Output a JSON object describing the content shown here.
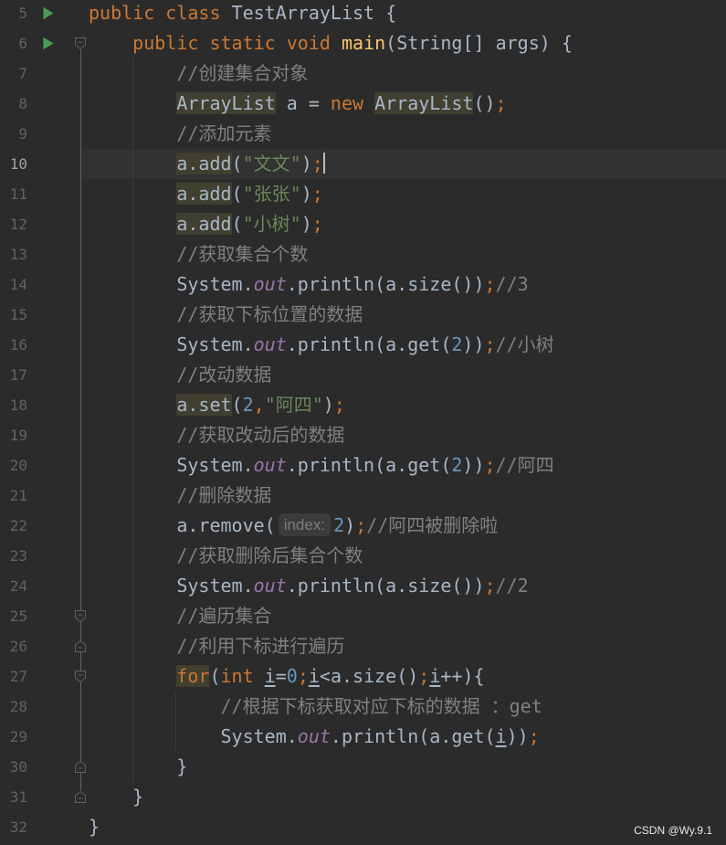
{
  "editor": {
    "theme": {
      "background": "#2b2b2b",
      "current_line_background": "#323232",
      "text": "#a9b7c6",
      "keyword": "#cc7832",
      "method": "#ffc66d",
      "comment": "#808080",
      "string": "#6a8759",
      "number": "#6897bb",
      "field": "#9876aa",
      "line_number": "#606366",
      "line_number_current": "#a4a3a3",
      "usage_highlight": "#403f30",
      "hint_background": "#3b3b3c",
      "hint_text": "#7e7e7e",
      "run_icon": "#499c54",
      "fold_marker": "#5f6366",
      "indent_guide": "#3c3c3c",
      "caret": "#bbbbbb"
    },
    "current_line": 10,
    "lines": [
      {
        "number": "5",
        "run_icon": "run-icon",
        "fold": null,
        "tokens": [
          {
            "type": "keyword",
            "text": "public"
          },
          {
            "type": "text",
            "text": " "
          },
          {
            "type": "keyword",
            "text": "class"
          },
          {
            "type": "text",
            "text": " TestArrayList {"
          }
        ]
      },
      {
        "number": "6",
        "run_icon": "run-icon",
        "fold": "fold-start-icon",
        "tokens": [
          {
            "type": "text",
            "text": "    "
          },
          {
            "type": "keyword",
            "text": "public"
          },
          {
            "type": "text",
            "text": " "
          },
          {
            "type": "keyword",
            "text": "static"
          },
          {
            "type": "text",
            "text": " "
          },
          {
            "type": "keyword",
            "text": "void"
          },
          {
            "type": "text",
            "text": " "
          },
          {
            "type": "method",
            "text": "main"
          },
          {
            "type": "text",
            "text": "(String[] args) {"
          }
        ]
      },
      {
        "number": "7",
        "run_icon": null,
        "fold": null,
        "tokens": [
          {
            "type": "text",
            "text": "        "
          },
          {
            "type": "comment",
            "text": "//创建集合对象"
          }
        ]
      },
      {
        "number": "8",
        "run_icon": null,
        "fold": null,
        "tokens": [
          {
            "type": "text",
            "text": "        "
          },
          {
            "type": "text",
            "text": "ArrayList",
            "highlight": true
          },
          {
            "type": "text",
            "text": " a = "
          },
          {
            "type": "keyword",
            "text": "new"
          },
          {
            "type": "text",
            "text": " "
          },
          {
            "type": "text",
            "text": "ArrayList",
            "highlight": true
          },
          {
            "type": "text",
            "text": "()"
          },
          {
            "type": "keyword",
            "text": ";"
          }
        ]
      },
      {
        "number": "9",
        "run_icon": null,
        "fold": null,
        "tokens": [
          {
            "type": "text",
            "text": "        "
          },
          {
            "type": "comment",
            "text": "//添加元素"
          }
        ]
      },
      {
        "number": "10",
        "run_icon": null,
        "fold": null,
        "caret": true,
        "tokens": [
          {
            "type": "text",
            "text": "        "
          },
          {
            "type": "text",
            "text": "a.add",
            "highlight": true
          },
          {
            "type": "text",
            "text": "("
          },
          {
            "type": "string",
            "text": "\"文文\""
          },
          {
            "type": "text",
            "text": ")"
          },
          {
            "type": "keyword",
            "text": ";"
          }
        ]
      },
      {
        "number": "11",
        "run_icon": null,
        "fold": null,
        "tokens": [
          {
            "type": "text",
            "text": "        "
          },
          {
            "type": "text",
            "text": "a.add",
            "highlight": true
          },
          {
            "type": "text",
            "text": "("
          },
          {
            "type": "string",
            "text": "\"张张\""
          },
          {
            "type": "text",
            "text": ")"
          },
          {
            "type": "keyword",
            "text": ";"
          }
        ]
      },
      {
        "number": "12",
        "run_icon": null,
        "fold": null,
        "tokens": [
          {
            "type": "text",
            "text": "        "
          },
          {
            "type": "text",
            "text": "a.add",
            "highlight": true
          },
          {
            "type": "text",
            "text": "("
          },
          {
            "type": "string",
            "text": "\"小树\""
          },
          {
            "type": "text",
            "text": ")"
          },
          {
            "type": "keyword",
            "text": ";"
          }
        ]
      },
      {
        "number": "13",
        "run_icon": null,
        "fold": null,
        "tokens": [
          {
            "type": "text",
            "text": "        "
          },
          {
            "type": "comment",
            "text": "//获取集合个数"
          }
        ]
      },
      {
        "number": "14",
        "run_icon": null,
        "fold": null,
        "tokens": [
          {
            "type": "text",
            "text": "        "
          },
          {
            "type": "text",
            "text": "System."
          },
          {
            "type": "field",
            "text": "out"
          },
          {
            "type": "text",
            "text": ".println(a.size())"
          },
          {
            "type": "keyword",
            "text": ";"
          },
          {
            "type": "comment",
            "text": "//3"
          }
        ]
      },
      {
        "number": "15",
        "run_icon": null,
        "fold": null,
        "tokens": [
          {
            "type": "text",
            "text": "        "
          },
          {
            "type": "comment",
            "text": "//获取下标位置的数据"
          }
        ]
      },
      {
        "number": "16",
        "run_icon": null,
        "fold": null,
        "tokens": [
          {
            "type": "text",
            "text": "        "
          },
          {
            "type": "text",
            "text": "System."
          },
          {
            "type": "field",
            "text": "out"
          },
          {
            "type": "text",
            "text": ".println(a.get("
          },
          {
            "type": "number",
            "text": "2"
          },
          {
            "type": "text",
            "text": "))"
          },
          {
            "type": "keyword",
            "text": ";"
          },
          {
            "type": "comment",
            "text": "//小树"
          }
        ]
      },
      {
        "number": "17",
        "run_icon": null,
        "fold": null,
        "tokens": [
          {
            "type": "text",
            "text": "        "
          },
          {
            "type": "comment",
            "text": "//改动数据"
          }
        ]
      },
      {
        "number": "18",
        "run_icon": null,
        "fold": null,
        "tokens": [
          {
            "type": "text",
            "text": "        "
          },
          {
            "type": "text",
            "text": "a.set",
            "highlight": true
          },
          {
            "type": "text",
            "text": "("
          },
          {
            "type": "number",
            "text": "2"
          },
          {
            "type": "keyword",
            "text": ","
          },
          {
            "type": "string",
            "text": "\"阿四\""
          },
          {
            "type": "text",
            "text": ")"
          },
          {
            "type": "keyword",
            "text": ";"
          }
        ]
      },
      {
        "number": "19",
        "run_icon": null,
        "fold": null,
        "tokens": [
          {
            "type": "text",
            "text": "        "
          },
          {
            "type": "comment",
            "text": "//获取改动后的数据"
          }
        ]
      },
      {
        "number": "20",
        "run_icon": null,
        "fold": null,
        "tokens": [
          {
            "type": "text",
            "text": "        "
          },
          {
            "type": "text",
            "text": "System."
          },
          {
            "type": "field",
            "text": "out"
          },
          {
            "type": "text",
            "text": ".println(a.get("
          },
          {
            "type": "number",
            "text": "2"
          },
          {
            "type": "text",
            "text": "))"
          },
          {
            "type": "keyword",
            "text": ";"
          },
          {
            "type": "comment",
            "text": "//阿四"
          }
        ]
      },
      {
        "number": "21",
        "run_icon": null,
        "fold": null,
        "tokens": [
          {
            "type": "text",
            "text": "        "
          },
          {
            "type": "comment",
            "text": "//删除数据"
          }
        ]
      },
      {
        "number": "22",
        "run_icon": null,
        "fold": null,
        "tokens": [
          {
            "type": "text",
            "text": "        "
          },
          {
            "type": "text",
            "text": "a.remove("
          },
          {
            "type": "hint",
            "text": "index:"
          },
          {
            "type": "number",
            "text": "2"
          },
          {
            "type": "text",
            "text": ")"
          },
          {
            "type": "keyword",
            "text": ";"
          },
          {
            "type": "comment",
            "text": "//阿四被删除啦"
          }
        ]
      },
      {
        "number": "23",
        "run_icon": null,
        "fold": null,
        "tokens": [
          {
            "type": "text",
            "text": "        "
          },
          {
            "type": "comment",
            "text": "//获取删除后集合个数"
          }
        ]
      },
      {
        "number": "24",
        "run_icon": null,
        "fold": null,
        "tokens": [
          {
            "type": "text",
            "text": "        "
          },
          {
            "type": "text",
            "text": "System."
          },
          {
            "type": "field",
            "text": "out"
          },
          {
            "type": "text",
            "text": ".println(a.size())"
          },
          {
            "type": "keyword",
            "text": ";"
          },
          {
            "type": "comment",
            "text": "//2"
          }
        ]
      },
      {
        "number": "25",
        "run_icon": null,
        "fold": "fold-start-icon",
        "tokens": [
          {
            "type": "text",
            "text": "        "
          },
          {
            "type": "comment",
            "text": "//遍历集合"
          }
        ]
      },
      {
        "number": "26",
        "run_icon": null,
        "fold": "fold-end-icon",
        "tokens": [
          {
            "type": "text",
            "text": "        "
          },
          {
            "type": "comment",
            "text": "//利用下标进行遍历"
          }
        ]
      },
      {
        "number": "27",
        "run_icon": null,
        "fold": "fold-start-icon",
        "tokens": [
          {
            "type": "text",
            "text": "        "
          },
          {
            "type": "keyword",
            "text": "for",
            "highlight": true
          },
          {
            "type": "text",
            "text": "("
          },
          {
            "type": "keyword",
            "text": "int"
          },
          {
            "type": "text",
            "text": " "
          },
          {
            "type": "var",
            "text": "i"
          },
          {
            "type": "text",
            "text": "="
          },
          {
            "type": "number",
            "text": "0"
          },
          {
            "type": "keyword",
            "text": ";"
          },
          {
            "type": "var",
            "text": "i"
          },
          {
            "type": "text",
            "text": "<a.size()"
          },
          {
            "type": "keyword",
            "text": ";"
          },
          {
            "type": "var",
            "text": "i"
          },
          {
            "type": "text",
            "text": "++){"
          }
        ]
      },
      {
        "number": "28",
        "run_icon": null,
        "fold": null,
        "tokens": [
          {
            "type": "text",
            "text": "            "
          },
          {
            "type": "comment",
            "text": "//根据下标获取对应下标的数据 ：get"
          }
        ]
      },
      {
        "number": "29",
        "run_icon": null,
        "fold": null,
        "tokens": [
          {
            "type": "text",
            "text": "            "
          },
          {
            "type": "text",
            "text": "System."
          },
          {
            "type": "field",
            "text": "out"
          },
          {
            "type": "text",
            "text": ".println(a.get("
          },
          {
            "type": "var",
            "text": "i"
          },
          {
            "type": "text",
            "text": "))"
          },
          {
            "type": "keyword",
            "text": ";"
          }
        ]
      },
      {
        "number": "30",
        "run_icon": null,
        "fold": "fold-end-icon",
        "tokens": [
          {
            "type": "text",
            "text": "        "
          },
          {
            "type": "text",
            "text": "}"
          }
        ]
      },
      {
        "number": "31",
        "run_icon": null,
        "fold": "fold-end-icon",
        "tokens": [
          {
            "type": "text",
            "text": "    "
          },
          {
            "type": "text",
            "text": "}"
          }
        ]
      },
      {
        "number": "32",
        "run_icon": null,
        "fold": null,
        "tokens": [
          {
            "type": "text",
            "text": "}"
          }
        ]
      }
    ]
  },
  "watermark": "CSDN @Wy.9.1"
}
